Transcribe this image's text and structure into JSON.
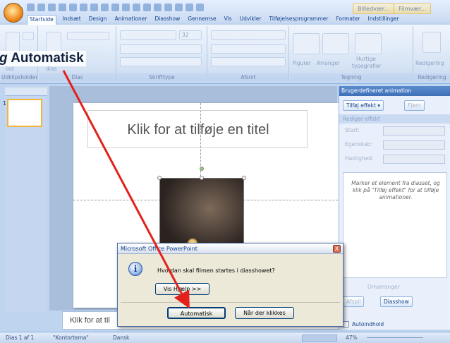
{
  "ribbon": {
    "tabs": [
      "Startside",
      "Indsæt",
      "Design",
      "Animationer",
      "Diasshow",
      "Gennemse",
      "Vis",
      "Udvikler",
      "Tilføjelsesprogrammer",
      "Formater",
      "Indstillinger"
    ],
    "context_tabs": [
      "Billedvær...",
      "Filmvær..."
    ],
    "groups": [
      "Udklipsholder",
      "Dias",
      "Skrifttype",
      "Afsnit",
      "Tegning",
      "Redigering"
    ],
    "buttons": {
      "ind": "ind",
      "dias": "dias",
      "figurer": "Figurer",
      "arranger": "Arranger",
      "hurtige": "Hurtige",
      "typografier": "typografier",
      "redigering": "Redigering",
      "font_size": "32"
    }
  },
  "slide": {
    "title_placeholder": "Klik for at tilføje en titel",
    "notes_placeholder": "Klik for at til",
    "thumbnail_number": "1"
  },
  "task_pane": {
    "header": "Brugerdefineret animation",
    "add_effect": "Tilføj effekt",
    "remove": "Fjern",
    "edit_effect_label": "Rediger effekt",
    "start_label": "Start:",
    "property_label": "Egenskab:",
    "speed_label": "Hastighed:",
    "help_text": "Marker et element fra diasset, og klik på \"Tilføj effekt\" for at tilføje animationer.",
    "reorder": "Omarranger",
    "play": "Afspil",
    "slideshow": "Diasshow",
    "autopreview": "Autoindhold"
  },
  "dialog": {
    "title": "Microsoft Office PowerPoint",
    "question": "Hvordan skal filmen startes i diasshowet?",
    "help_button": "Vis Hjælp >>",
    "automatic_button": "Automatisk",
    "on_click_button": "Når der klikkes",
    "close": "X"
  },
  "statusbar": {
    "slide_info": "Dias 1 af 1",
    "theme": "\"Kontortema\"",
    "language": "Dansk",
    "zoom": "47%"
  },
  "annotation": {
    "prefix": "g",
    "label": "Automatisk"
  }
}
